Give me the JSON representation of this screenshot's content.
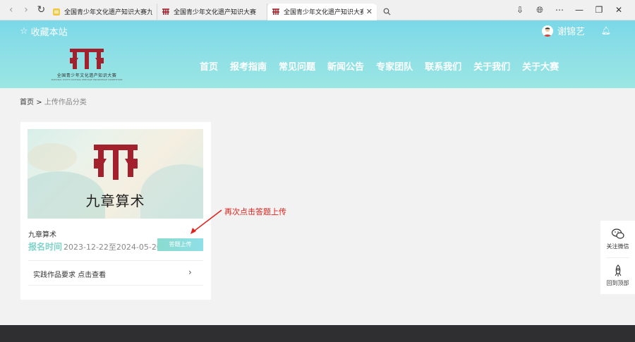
{
  "browser": {
    "tabs": [
      {
        "label": "全国青少年文化遗产知识大赛九章"
      },
      {
        "label": "全国青少年文化遗产知识大赛"
      },
      {
        "label": "全国青少年文化遗产知识大赛"
      }
    ]
  },
  "header": {
    "favorite": "收藏本站",
    "user_name": "谢锦艺",
    "logo_text": "全国青少年文化遗产知识大赛",
    "logo_sub": "NATIONAL YOUTH CULTURAL HERITAGE KNOWLEDGE COMPETITION",
    "nav": [
      "首页",
      "报考指南",
      "常见问题",
      "新闻公告",
      "专家团队",
      "联系我们",
      "关于我们",
      "关于大赛"
    ]
  },
  "breadcrumb": {
    "home": "首页",
    "separator": ">",
    "current": "上传作品分类"
  },
  "card": {
    "banner_title": "九章算术",
    "title": "九章算术",
    "reg_label": "报名时间",
    "reg_dates": "2023-12-22至2024-05-20",
    "upload_button": "答题上传",
    "requirement_link": "实践作品要求 点击查看"
  },
  "annotation": {
    "text": "再次点击答题上传",
    "color": "#e0221c"
  },
  "side_float": {
    "follow": "关注微信",
    "back_top": "回到顶部"
  },
  "colors": {
    "header_start": "#7ad8e8",
    "header_end": "#9ae6e2",
    "accent": "#7fd3c9",
    "logo_red": "#a3212c",
    "footer": "#2f2f31"
  }
}
